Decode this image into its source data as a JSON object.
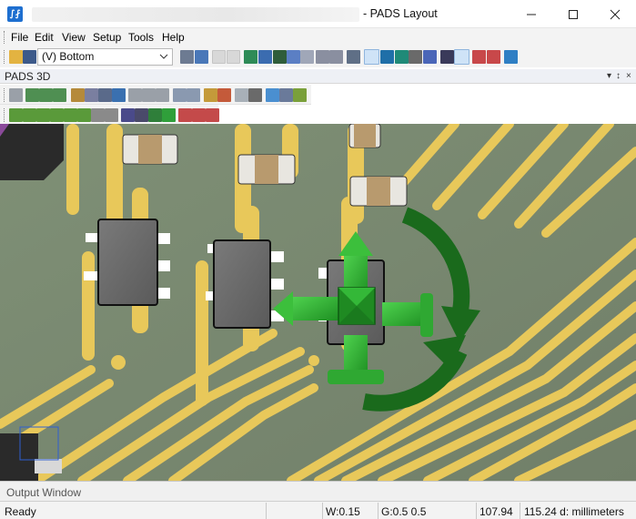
{
  "window": {
    "app_icon_glyph": "∫⨏",
    "title": "- PADS Layout",
    "controls": [
      "minimize",
      "maximize",
      "close"
    ]
  },
  "menu": {
    "items": [
      "File",
      "Edit",
      "View",
      "Setup",
      "Tools",
      "Help"
    ]
  },
  "toolbar": {
    "view_select_value": "(V) Bottom"
  },
  "tool_window": {
    "title": "PADS 3D",
    "pin_glyph": "▾",
    "close_glyph": "×"
  },
  "output_window": {
    "label": "Output Window"
  },
  "status": {
    "state": "Ready",
    "width": "W:0.15",
    "grid": "G:0.5 0.5",
    "x": "107.94",
    "y_units": "115.24 d: millimeters"
  },
  "colors": {
    "board": "#7a8b72",
    "trace": "#e8c85a",
    "component_body": "#6c6c6c",
    "gizmo_green": "#2fa832",
    "gizmo_dark_green": "#1a6a1c"
  }
}
